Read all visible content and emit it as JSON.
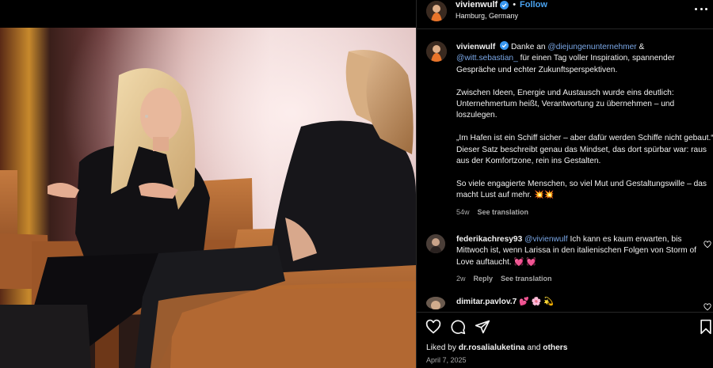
{
  "post": {
    "username": "vivienwulf",
    "follow_label": "Follow",
    "separator": "•",
    "location": "Hamburg, Germany"
  },
  "caption": {
    "username": "vivienwulf",
    "line1_pre": "Danke an ",
    "mention1": "@diejungenunternehmer",
    "line1_post": " &",
    "mention2": "@witt.sebastian_",
    "line1_rest": " für einen Tag voller Inspiration, spannender Gespräche und echter Zukunftsperspektiven.",
    "para2": "Zwischen Ideen, Energie und Austausch wurde eins deutlich: Unternehmertum heißt, Verantwortung zu übernehmen – und loszulegen.",
    "para3a": "„Im Hafen ist ein Schiff sicher – aber dafür werden Schiffe nicht gebaut.“",
    "para3b": "Dieser Satz beschreibt genau das Mindset, das dort spürbar war: raus aus der Komfortzone, rein ins Gestalten.",
    "para4": "So viele engagierte Menschen, so viel Mut und Gestaltungswille – das macht Lust auf mehr. 💥💥",
    "age": "54w",
    "see_translation": "See translation"
  },
  "comments": [
    {
      "username": "federikachresy93",
      "mention": "@vivienwulf",
      "text": " Ich kann es kaum erwarten, bis Mittwoch ist, wenn Larissa in den italienischen Folgen von Storm of Love auftaucht. 💓 💓",
      "age": "2w",
      "reply": "Reply",
      "see_translation": "See translation"
    },
    {
      "username": "dimitar.pavlov.7",
      "text": " 💕 🌸 💫"
    }
  ],
  "likes": {
    "prefix": "Liked by ",
    "user": "dr.rosalialuketina",
    "joiner": " and ",
    "others": "others"
  },
  "date": "April 7, 2025",
  "icons": {
    "verified": "verified-badge-icon",
    "more": "more-options-icon",
    "like": "heart-icon",
    "comment": "comment-bubble-icon",
    "share": "paper-plane-icon",
    "save": "bookmark-icon"
  },
  "colors": {
    "background": "#000000",
    "link_blue": "#4aa3f0",
    "mention": "#7aa7e6",
    "secondary_text": "#a8a8a8",
    "divider": "#262626",
    "heart_red": "#ff3040"
  }
}
